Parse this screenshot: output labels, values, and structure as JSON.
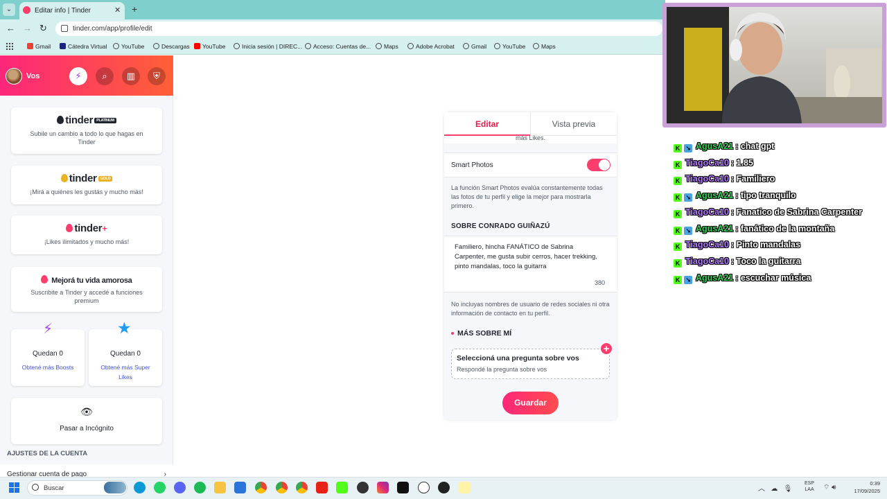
{
  "browser": {
    "tab_title": "Editar info | Tinder",
    "url": "tinder.com/app/profile/edit",
    "bookmarks": [
      {
        "label": "Gmail",
        "color": "#ea4335"
      },
      {
        "label": "Cátedra Virtual",
        "color": "#1a237e"
      },
      {
        "label": "YouTube",
        "color": "#444444"
      },
      {
        "label": "Descargas",
        "color": "#444444"
      },
      {
        "label": "YouTube",
        "color": "#ff0000"
      },
      {
        "label": "Inicia sesión | DIREC...",
        "color": "#444444"
      },
      {
        "label": "Acceso: Cuentas de...",
        "color": "#444444"
      },
      {
        "label": "Maps",
        "color": "#444444"
      },
      {
        "label": "Adobe Acrobat",
        "color": "#444444"
      },
      {
        "label": "Gmail",
        "color": "#444444"
      },
      {
        "label": "YouTube",
        "color": "#444444"
      },
      {
        "label": "Maps",
        "color": "#444444"
      }
    ]
  },
  "sidebar": {
    "profile_name": "Vos",
    "cards": [
      {
        "logo": "tinder",
        "badge": "PLATINUM",
        "subtitle": "Subile un cambio a todo lo que hagas en Tinder"
      },
      {
        "logo": "tinder",
        "badge": "GOLD",
        "subtitle": "¡Mirá a quiénes les gustás y mucho más!"
      },
      {
        "logo": "tinder",
        "badge": "+",
        "subtitle": "¡Likes ilimitados y mucho más!"
      },
      {
        "logo": "Mejorá tu vida amorosa",
        "subtitle": "Suscribite a Tinder y accedé a funciones premium"
      }
    ],
    "boosts": {
      "title": "Quedan 0",
      "link": "Obtené más Boosts"
    },
    "super_likes": {
      "title": "Quedan 0",
      "link": "Obtené más Super Likes"
    },
    "incognito": "Pasar a Incógnito",
    "section_title": "AJUSTES DE LA CUENTA",
    "manage_payment": "Gestionar cuenta de pago"
  },
  "editor": {
    "tab_edit": "Editar",
    "tab_preview": "Vista previa",
    "more_likes": "más Likes.",
    "smart_photos_label": "Smart Photos",
    "smart_photos_on": true,
    "smart_photos_desc": "La función Smart Photos evalúa constantemente todas las fotos de tu perfil y elige la mejor para mostrarla primero.",
    "about_heading": "SOBRE CONRADO GUIÑAZÚ",
    "bio": "Familiero, hincha FANÁTICO de Sabrina Carpenter, me gusta subir cerros, hacer trekking, pinto mandalas, toco la guitarra",
    "bio_remaining": "380",
    "bio_note": "No incluyas nombres de usuario de redes sociales ni otra información de contacto en tu perfil.",
    "more_about_heading": "MÁS SOBRE MÍ",
    "prompt_title": "Seleccioná una pregunta sobre vos",
    "prompt_subtitle": "Respondé la pregunta sobre vos",
    "save_label": "Guardar"
  },
  "chat": [
    {
      "user": "AgusA21",
      "message": ": chat gpt",
      "color": "#39d353"
    },
    {
      "user": "TiagoCa10",
      "message": ": 1.85",
      "color": "#b57bff"
    },
    {
      "user": "TiagoCa10",
      "message": ": Familiero",
      "color": "#b57bff"
    },
    {
      "user": "AgusA21",
      "message": ": tipo tranquilo",
      "color": "#39d353"
    },
    {
      "user": "TiagoCa10",
      "message": ": Fanatico de Sabrina Carpenter",
      "color": "#b57bff"
    },
    {
      "user": "AgusA21",
      "message": ": fanático de la montaña",
      "color": "#39d353"
    },
    {
      "user": "TiagoCa10",
      "message": ": Pinto mandalas",
      "color": "#b57bff"
    },
    {
      "user": "TiagoCa10",
      "message": ": Toco la guitarra",
      "color": "#b57bff"
    },
    {
      "user": "AgusA21",
      "message": ": escuchar música",
      "color": "#39d353"
    }
  ],
  "taskbar": {
    "search_placeholder": "Buscar",
    "lang_line1": "ESP",
    "lang_line2": "LAA",
    "time": "0:39",
    "date": "17/09/2025"
  },
  "colors": {
    "brand": "#fd3d6b",
    "brand_gradient_start": "#fd267a",
    "brand_gradient_end": "#ff6036"
  }
}
